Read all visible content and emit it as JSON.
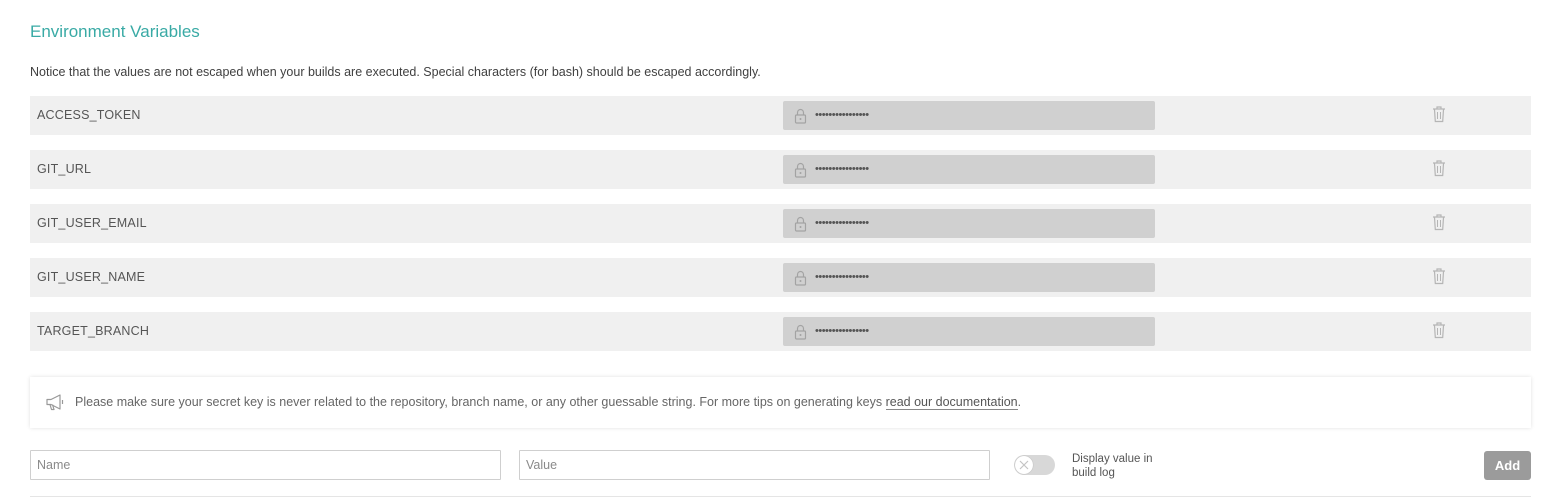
{
  "section": {
    "title": "Environment Variables",
    "notice": "Notice that the values are not escaped when your builds are executed. Special characters (for bash) should be escaped accordingly."
  },
  "variables": [
    {
      "name": "ACCESS_TOKEN",
      "masked_value": "••••••••••••••••"
    },
    {
      "name": "GIT_URL",
      "masked_value": "••••••••••••••••"
    },
    {
      "name": "GIT_USER_EMAIL",
      "masked_value": "••••••••••••••••"
    },
    {
      "name": "GIT_USER_NAME",
      "masked_value": "••••••••••••••••"
    },
    {
      "name": "TARGET_BRANCH",
      "masked_value": "••••••••••••••••"
    }
  ],
  "icons": {
    "value_lock": "lock-icon",
    "row_delete": "trash-icon",
    "tip": "megaphone-icon",
    "toggle_off": "close-icon"
  },
  "tip": {
    "text": "Please make sure your secret key is never related to the repository, branch name, or any other guessable string. For more tips on generating keys ",
    "link": "read our documentation",
    "suffix": "."
  },
  "form": {
    "name_placeholder": "Name",
    "value_placeholder": "Value",
    "toggle_label": "Display value in build log",
    "toggle_on": false,
    "add_label": "Add"
  },
  "colors": {
    "title": "#39aaa5",
    "row_bg": "#f0f0f0",
    "value_bg": "#d0d0d0",
    "add_button": "#9b9b9b"
  }
}
